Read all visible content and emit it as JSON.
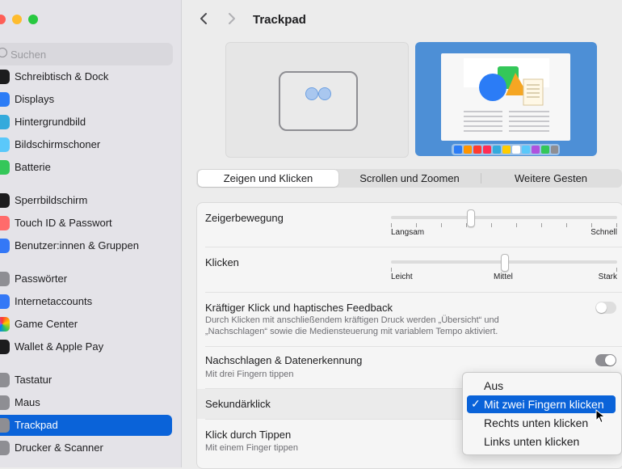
{
  "sidebar": {
    "search_placeholder": "Suchen",
    "items": [
      {
        "label": "Schreibtisch & Dock",
        "icon": "dock-icon",
        "color": "#1c1c1e"
      },
      {
        "label": "Displays",
        "icon": "display-icon",
        "color": "#2b7cf6"
      },
      {
        "label": "Hintergrundbild",
        "icon": "wallpaper-icon",
        "color": "#34aadc"
      },
      {
        "label": "Bildschirmschoner",
        "icon": "screensaver-icon",
        "color": "#5ac8fa"
      },
      {
        "label": "Batterie",
        "icon": "battery-icon",
        "color": "#34c759"
      },
      {
        "label": "Sperrbildschirm",
        "icon": "lock-icon",
        "color": "#1c1c1e"
      },
      {
        "label": "Touch ID & Passwort",
        "icon": "fingerprint-icon",
        "color": "#ff6b6b"
      },
      {
        "label": "Benutzer:innen & Gruppen",
        "icon": "users-icon",
        "color": "#3478f6"
      },
      {
        "label": "Passwörter",
        "icon": "key-icon",
        "color": "#8e8e93"
      },
      {
        "label": "Internetaccounts",
        "icon": "at-icon",
        "color": "#3478f6"
      },
      {
        "label": "Game Center",
        "icon": "game-center-icon",
        "color": "#f5a623"
      },
      {
        "label": "Wallet & Apple Pay",
        "icon": "wallet-icon",
        "color": "#1c1c1e"
      },
      {
        "label": "Tastatur",
        "icon": "keyboard-icon",
        "color": "#8e8e93"
      },
      {
        "label": "Maus",
        "icon": "mouse-icon",
        "color": "#8e8e93"
      },
      {
        "label": "Trackpad",
        "icon": "trackpad-icon",
        "color": "#8e8e93",
        "active": true
      },
      {
        "label": "Drucker & Scanner",
        "icon": "printer-icon",
        "color": "#8e8e93"
      }
    ]
  },
  "header": {
    "title": "Trackpad"
  },
  "tabs": [
    {
      "label": "Zeigen und Klicken",
      "selected": true
    },
    {
      "label": "Scrollen und Zoomen",
      "selected": false
    },
    {
      "label": "Weitere Gesten",
      "selected": false
    }
  ],
  "settings": {
    "tracking": {
      "label": "Zeigerbewegung",
      "min_label": "Langsam",
      "max_label": "Schnell",
      "ticks": 10,
      "value": 0.35
    },
    "click": {
      "label": "Klicken",
      "min_label": "Leicht",
      "mid_label": "Mittel",
      "max_label": "Stark",
      "ticks": 3,
      "value": 0.5
    },
    "force_click": {
      "label": "Kräftiger Klick und haptisches Feedback",
      "description_line1": "Durch Klicken mit anschließendem kräftigen Druck werden „Übersicht“ und",
      "description_line2": "„Nachschlagen“ sowie die Mediensteuerung mit variablem Tempo aktiviert.",
      "enabled": false
    },
    "lookup": {
      "label": "Nachschlagen & Datenerkennung",
      "description": "Mit drei Fingern tippen",
      "enabled": true
    },
    "secondary_click": {
      "label": "Sekundärklick"
    },
    "tap_to_click": {
      "label": "Klick durch Tippen",
      "description": "Mit einem Finger tippen"
    }
  },
  "dropdown": {
    "options": [
      "Aus",
      "Mit zwei Fingern klicken",
      "Rechts unten klicken",
      "Links unten klicken"
    ],
    "selected_index": 1,
    "check": "✓"
  },
  "colors": {
    "accent": "#0a63d9",
    "toggle_off": "#dedede",
    "toggle_on_gray": "#8e8e93"
  }
}
